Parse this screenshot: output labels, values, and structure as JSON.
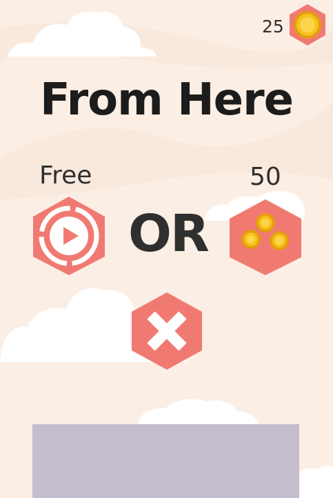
{
  "hud": {
    "coin_count": "25",
    "coin_icon": "gold-coin-icon"
  },
  "dialog": {
    "title": "From Here",
    "free_option": {
      "label": "Free",
      "icon": "play-video-icon"
    },
    "separator": "OR",
    "paid_option": {
      "label": "50",
      "icon": "coins-icon"
    },
    "close_icon": "close-x-icon"
  },
  "colors": {
    "background": "#fbeee4",
    "cloud": "#ffffff",
    "button": "#f07a72",
    "coin": "#f6c21e",
    "banner": "#c5bccd"
  }
}
